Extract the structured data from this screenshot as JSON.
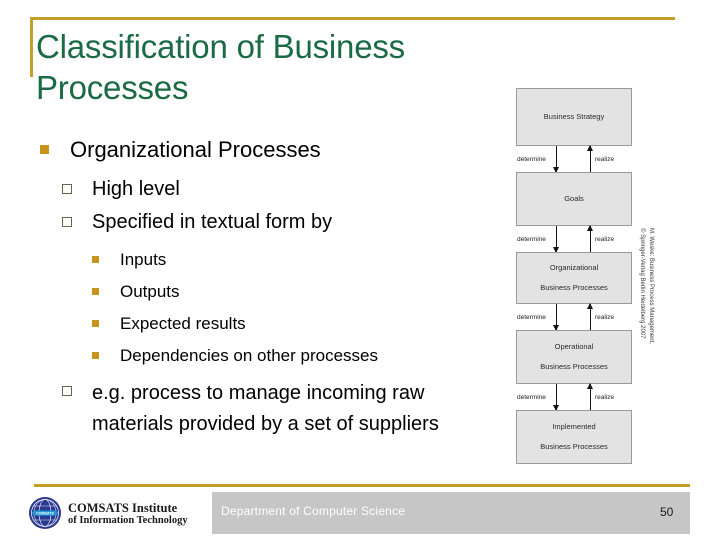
{
  "slide": {
    "title": "Classification of Business Processes",
    "accent_gold": "#C2A02A",
    "title_green": "#1A6B43",
    "bullet_gold": "#C7931B"
  },
  "content": {
    "level1": {
      "text": "Organizational Processes"
    },
    "level2": [
      {
        "text": "High level"
      },
      {
        "text": "Specified in textual form by"
      },
      {
        "text": "e.g. process to manage incoming raw materials provided by a set of suppliers"
      }
    ],
    "level3": [
      {
        "text": "Inputs"
      },
      {
        "text": "Outputs"
      },
      {
        "text": "Expected results"
      },
      {
        "text": "Dependencies on other processes"
      }
    ]
  },
  "diagram": {
    "boxes": [
      {
        "line1": "Business Strategy",
        "line2": ""
      },
      {
        "line1": "Goals",
        "line2": ""
      },
      {
        "line1": "Organizational",
        "line2": "Business Processes"
      },
      {
        "line1": "Operational",
        "line2": "Business Processes"
      },
      {
        "line1": "Implemented",
        "line2": "Business Processes"
      }
    ],
    "connectors": [
      {
        "down_label": "determine",
        "up_label": "realize"
      },
      {
        "down_label": "determine",
        "up_label": "realize"
      },
      {
        "down_label": "determine",
        "up_label": "realize"
      },
      {
        "down_label": "determine",
        "up_label": "realize"
      }
    ],
    "attribution_line1": "M. Weske: Business Process Management,",
    "attribution_line2": "© Springer-Verlag Berlin Heidelberg 2007"
  },
  "footer": {
    "department": "Department of Computer Science",
    "page_number": "50",
    "logo_line1": "COMSATS Institute",
    "logo_line2": "of Information Technology"
  }
}
